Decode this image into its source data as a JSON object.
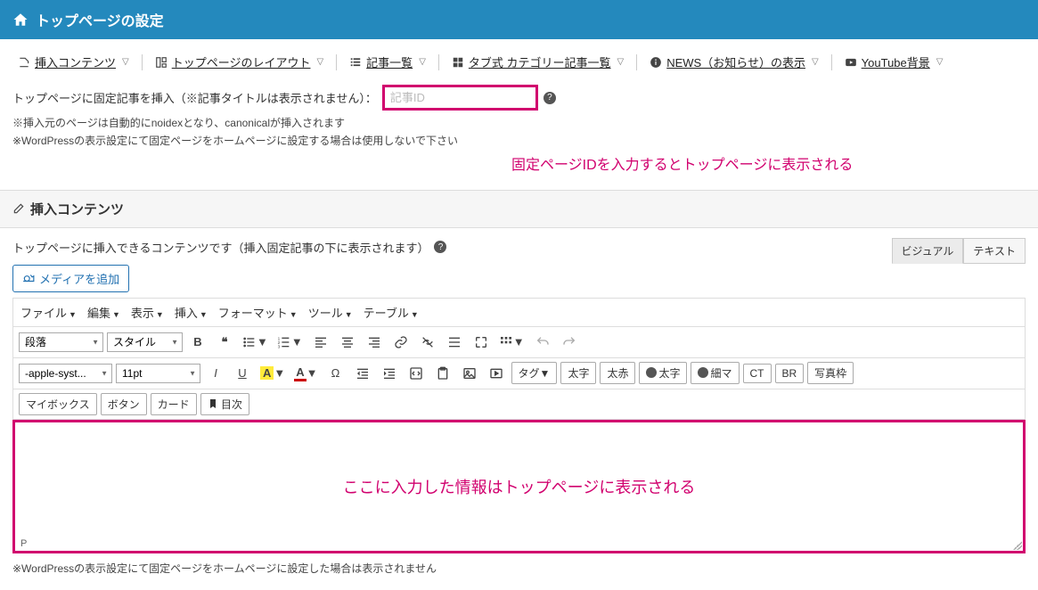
{
  "header": {
    "title": "トップページの設定"
  },
  "tabs": [
    {
      "label": "挿入コンテンツ",
      "icon": "edit"
    },
    {
      "label": "トップページのレイアウト",
      "icon": "layout"
    },
    {
      "label": "記事一覧",
      "icon": "list"
    },
    {
      "label": "タブ式 カテゴリー記事一覧",
      "icon": "grid"
    },
    {
      "label": "NEWS（お知らせ）の表示",
      "icon": "info"
    },
    {
      "label": "YouTube背景",
      "icon": "video"
    }
  ],
  "fixed_post": {
    "label": "トップページに固定記事を挿入（※記事タイトルは表示されません）：",
    "placeholder": "記事ID",
    "note1": "※挿入元のページは自動的にnoidexとなり、canonicalが挿入されます",
    "note2": "※WordPressの表示設定にて固定ページをホームページに設定する場合は使用しないで下さい",
    "annotation": "固定ページIDを入力するとトップページに表示される"
  },
  "section": {
    "title": "挿入コンテンツ"
  },
  "desc": "トップページに挿入できるコンテンツです（挿入固定記事の下に表示されます）",
  "media_btn": "メディアを追加",
  "editor_tabs": {
    "visual": "ビジュアル",
    "text": "テキスト"
  },
  "menubar": [
    "ファイル",
    "編集",
    "表示",
    "挿入",
    "フォーマット",
    "ツール",
    "テーブル"
  ],
  "toolbar": {
    "row1": {
      "paragraph": "段落",
      "style": "スタイル"
    },
    "row2": {
      "font": "-apple-syst...",
      "size": "11pt",
      "tag": "タグ",
      "bold_jp": "太字",
      "red_jp": "太赤",
      "bold_user": "太字",
      "thin_user": "細マ",
      "ct": "CT",
      "br": "BR",
      "photo": "写真枠"
    },
    "row3": {
      "mybox": "マイボックス",
      "button": "ボタン",
      "card": "カード",
      "toc": "目次"
    }
  },
  "editor": {
    "annotation": "ここに入力した情報はトップページに表示される",
    "status": "P"
  },
  "footer_note": "※WordPressの表示設定にて固定ページをホームページに設定した場合は表示されません"
}
